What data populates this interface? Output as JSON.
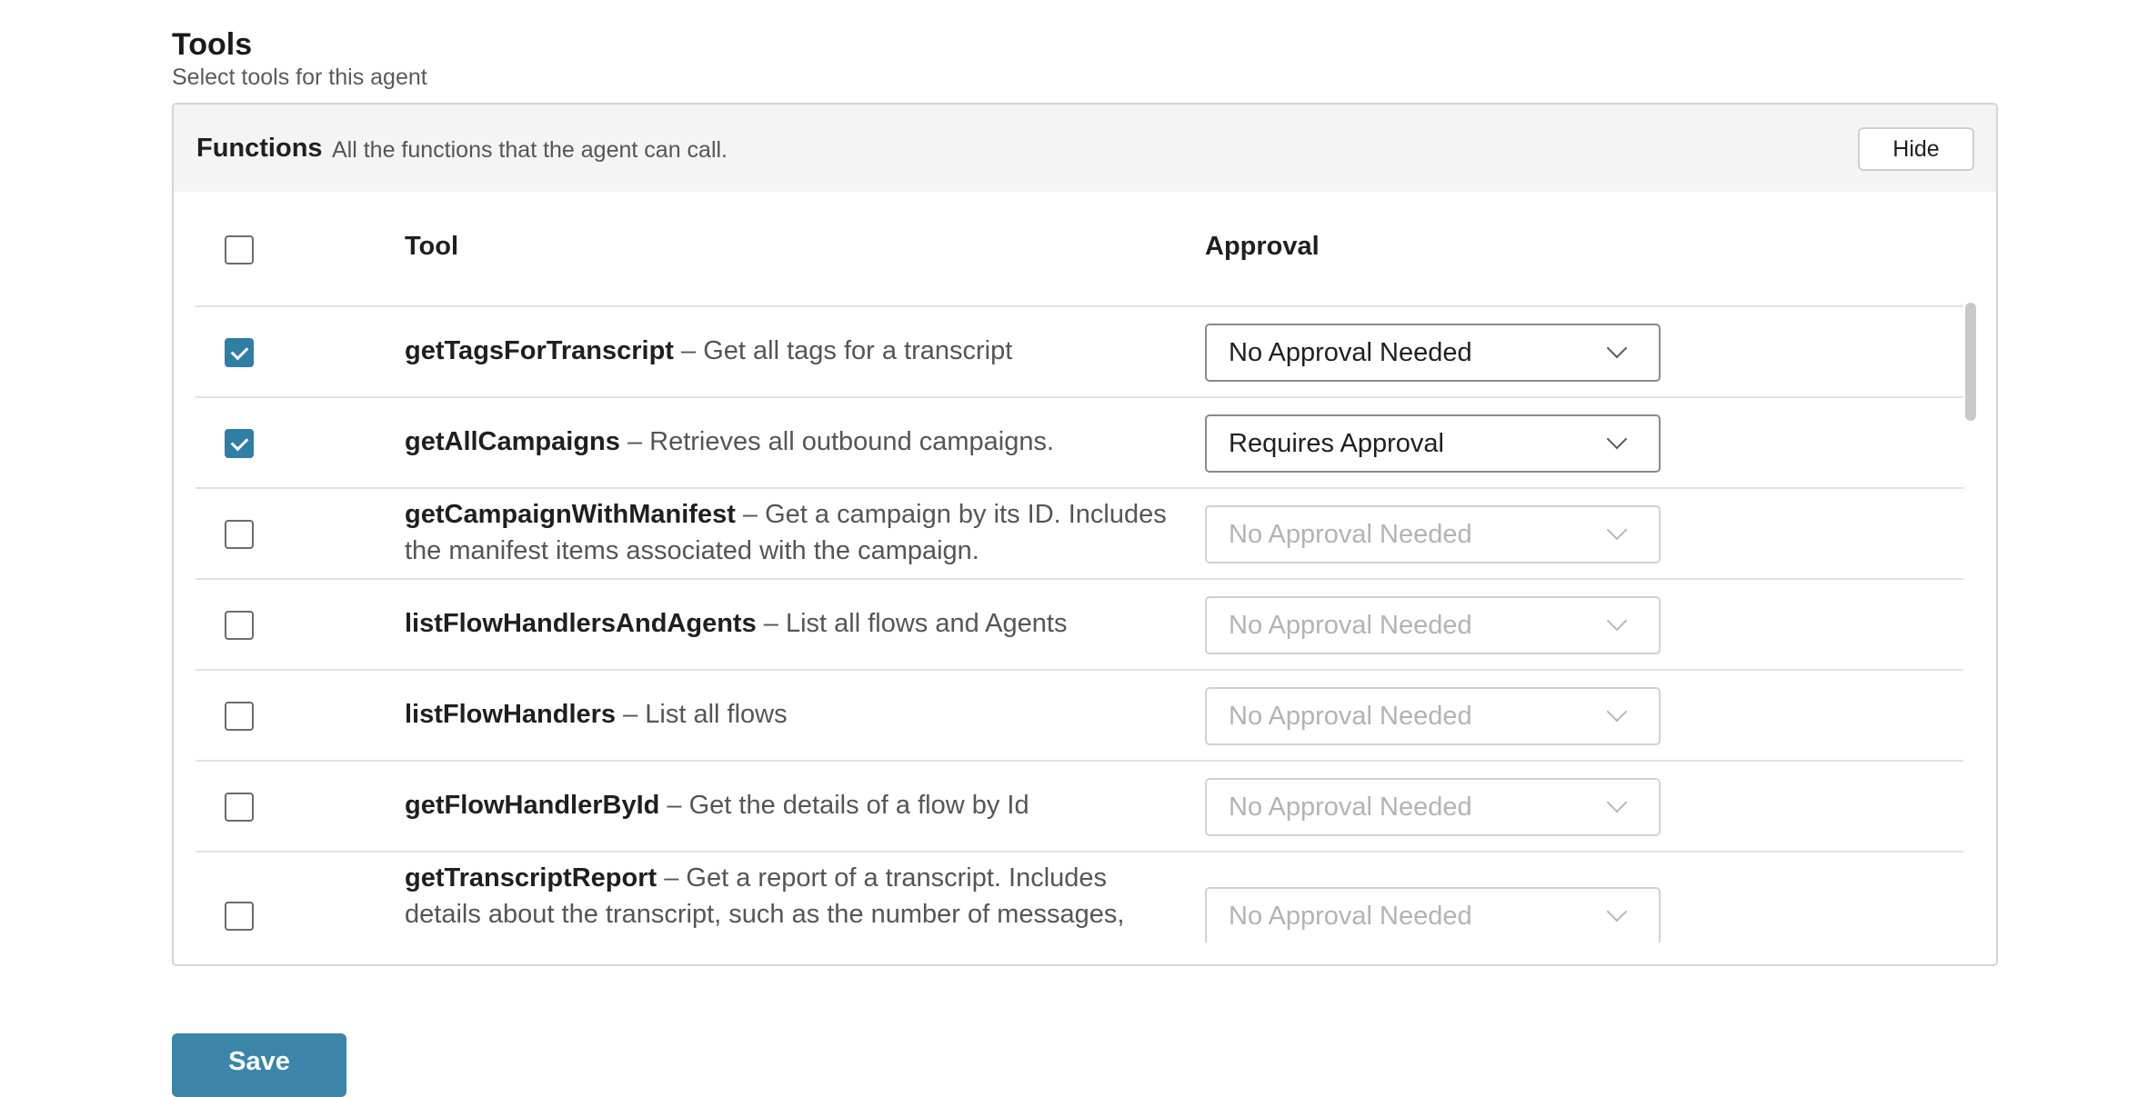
{
  "tools_section": {
    "title": "Tools",
    "subtitle": "Select tools for this agent"
  },
  "functions_panel": {
    "title": "Functions",
    "description": "All the functions that the agent can call.",
    "hide_label": "Hide"
  },
  "table": {
    "headers": {
      "tool": "Tool",
      "approval": "Approval"
    },
    "select_all_checked": false,
    "rows": [
      {
        "name": "getTagsForTranscript",
        "description": "– Get all tags for a transcript",
        "checked": true,
        "approval": "No Approval Needed",
        "approval_enabled": true
      },
      {
        "name": "getAllCampaigns",
        "description": "– Retrieves all outbound campaigns.",
        "checked": true,
        "approval": "Requires Approval",
        "approval_enabled": true
      },
      {
        "name": "getCampaignWithManifest",
        "description": "– Get a campaign by its ID. Includes the manifest items associated with the campaign.",
        "checked": false,
        "approval": "No Approval Needed",
        "approval_enabled": false
      },
      {
        "name": "listFlowHandlersAndAgents",
        "description": "– List all flows and Agents",
        "checked": false,
        "approval": "No Approval Needed",
        "approval_enabled": false
      },
      {
        "name": "listFlowHandlers",
        "description": "– List all flows",
        "checked": false,
        "approval": "No Approval Needed",
        "approval_enabled": false
      },
      {
        "name": "getFlowHandlerById",
        "description": "– Get the details of a flow by Id",
        "checked": false,
        "approval": "No Approval Needed",
        "approval_enabled": false
      },
      {
        "name": "getTranscriptReport",
        "description": "– Get a report of a transcript. Includes details about the transcript, such as the number of messages,",
        "checked": false,
        "approval": "No Approval Needed",
        "approval_enabled": false
      }
    ]
  },
  "actions": {
    "save_label": "Save"
  },
  "colors": {
    "accent": "#3b85a9",
    "checkbox_checked": "#2f7ea4"
  }
}
